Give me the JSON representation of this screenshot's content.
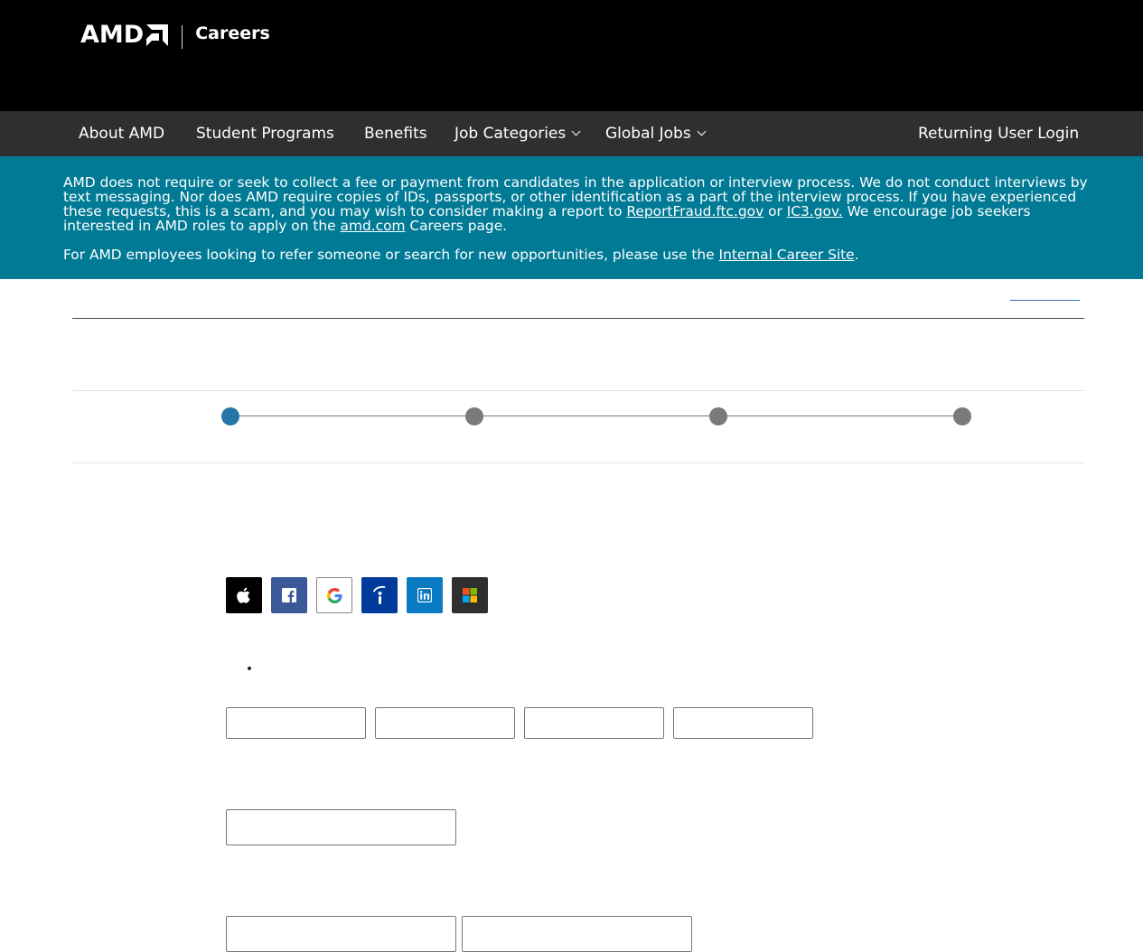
{
  "header": {
    "logo_text": "AMD",
    "section_title": "Careers"
  },
  "nav": {
    "items": [
      {
        "label": "About AMD",
        "has_dropdown": false
      },
      {
        "label": "Student Programs",
        "has_dropdown": false
      },
      {
        "label": "Benefits",
        "has_dropdown": false
      },
      {
        "label": "Job Categories",
        "has_dropdown": true
      },
      {
        "label": "Global Jobs",
        "has_dropdown": true
      }
    ],
    "login_label": "Returning User Login"
  },
  "notice": {
    "p1_text_a": "AMD does not require or seek to collect a fee or payment from candidates in the application or interview process. We do not conduct interviews by text messaging. Nor does AMD require copies of IDs, passports, or other identification as a part of the interview process. If you have experienced these requests, this is a scam, and you may wish to consider making a report to ",
    "link_ftc": "ReportFraud.ftc.gov",
    "p1_text_b": " or ",
    "link_ic3": "IC3.gov.",
    "p1_text_c": " We encourage job seekers interested in AMD roles to apply on the ",
    "link_amd": "amd.com",
    "p1_text_d": " Careers page.",
    "p2_text_a": "For AMD employees looking to refer someone or search for new opportunities, please use the ",
    "link_internal": "Internal Career Site",
    "p2_text_b": "."
  },
  "stepper": {
    "total_steps": 4,
    "active_step": 1
  },
  "social_logins": [
    {
      "icon": "apple-icon",
      "bg": "#000000"
    },
    {
      "icon": "facebook-icon",
      "bg": "#3b5998"
    },
    {
      "icon": "google-icon",
      "bg": "#ffffff"
    },
    {
      "icon": "indeed-icon",
      "bg": "#003a9b"
    },
    {
      "icon": "linkedin-icon",
      "bg": "#0a7bc2"
    },
    {
      "icon": "microsoft-icon",
      "bg": "#2f2f2f"
    }
  ],
  "colors": {
    "header_bg": "#000000",
    "nav_bg": "#2f2f30",
    "notice_bg": "#007a95",
    "step_active": "#2476a6",
    "step_inactive": "#7a7a7a"
  }
}
